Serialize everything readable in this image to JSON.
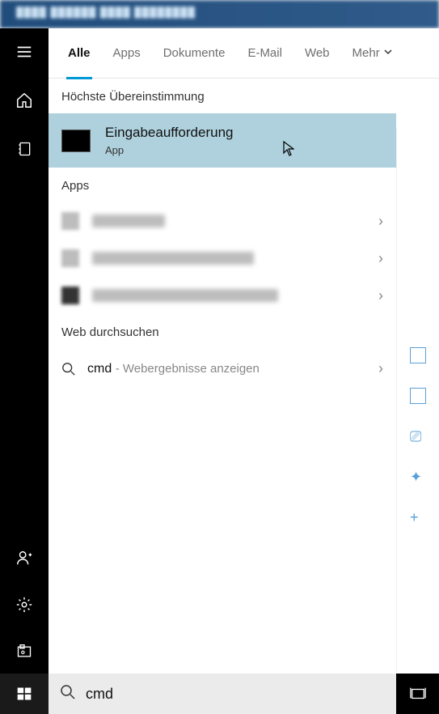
{
  "titlebar": {
    "blurred_text": "████ ██████ ████ ████████"
  },
  "tabs": {
    "items": [
      {
        "label": "Alle",
        "active": true
      },
      {
        "label": "Apps",
        "active": false
      },
      {
        "label": "Dokumente",
        "active": false
      },
      {
        "label": "E-Mail",
        "active": false
      },
      {
        "label": "Web",
        "active": false
      }
    ],
    "more_label": "Mehr"
  },
  "sections": {
    "best_match_header": "Höchste Übereinstimmung",
    "best_match": {
      "title": "Eingabeaufforderung",
      "subtitle": "App"
    },
    "apps_header": "Apps",
    "web_header": "Web durchsuchen",
    "web_result": {
      "query": "cmd",
      "desc": "- Webergebnisse anzeigen"
    }
  },
  "search": {
    "value": "cmd",
    "placeholder": ""
  },
  "rail": {
    "icons": [
      "menu",
      "home",
      "notebook"
    ],
    "bottom_icons": [
      "account-add",
      "settings",
      "picture"
    ]
  }
}
